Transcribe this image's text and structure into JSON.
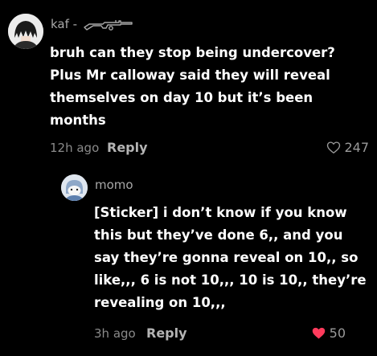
{
  "comments": [
    {
      "username_prefix": "kaf - ",
      "username_icon": "rifle-icon",
      "body_lines": [
        "bruh can they stop being undercover?",
        "Plus Mr calloway said they will reveal",
        "themselves on day 10 but it’s been",
        "months"
      ],
      "time": "12h ago",
      "reply_label": "Reply",
      "like_count": "247",
      "liked": false
    },
    {
      "username": "momo",
      "body_lines": [
        "[Sticker] i don’t know if you know",
        "this but they’ve done 6,, and you",
        "say they’re gonna reveal on 10,, so",
        "like,,, 6 is not 10,,, 10 is 10,, they’re",
        "revealing on 10,,,"
      ],
      "time": "3h ago",
      "reply_label": "Reply",
      "like_count": "50",
      "liked": true
    }
  ],
  "colors": {
    "background": "#000000",
    "text": "#ffffff",
    "muted": "#8a8a8a",
    "liked": "#ff3b5c"
  }
}
